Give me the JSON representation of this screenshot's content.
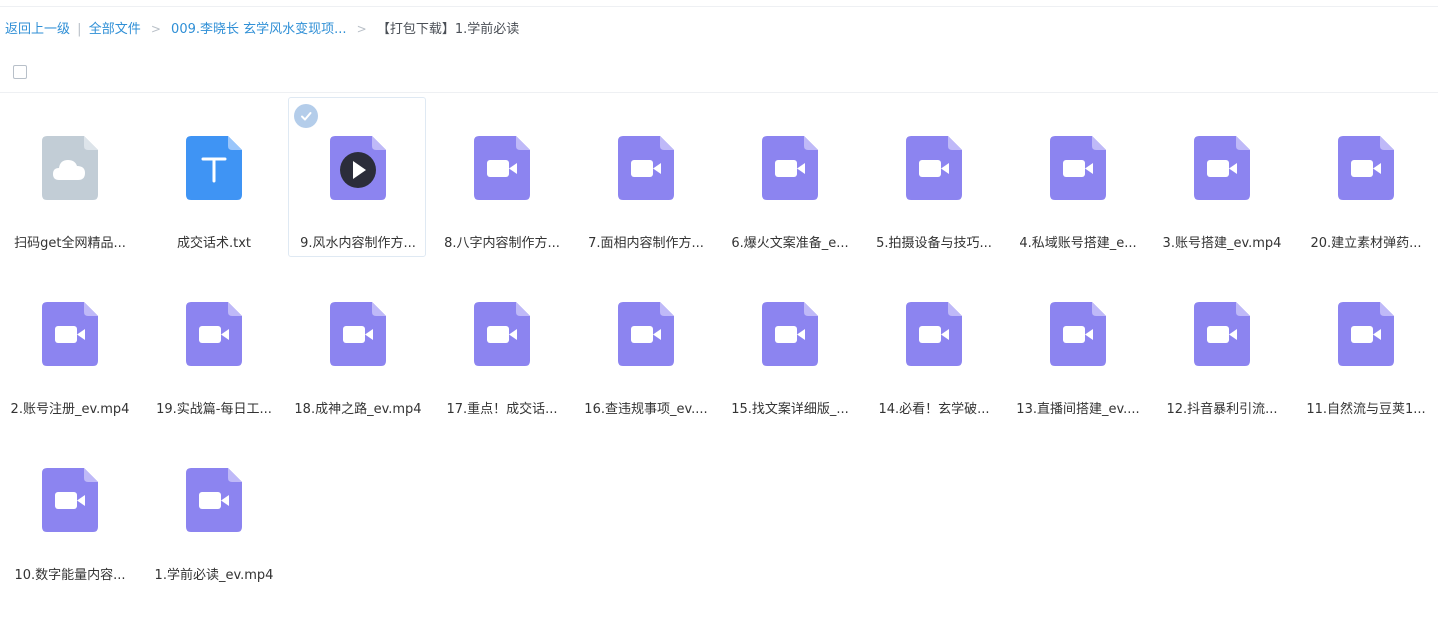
{
  "breadcrumb": {
    "back_label": "返回上一级",
    "sep": "|",
    "all_files": "全部文件",
    "folder": "009.李晓长 玄学风水变现项...",
    "arrow": ">",
    "current": "【打包下载】1.学前必读"
  },
  "colors": {
    "video": "#8c84f0",
    "video_fold": "#bfb9f8",
    "txt": "#3f94f4",
    "txt_fold": "#9ac6fb",
    "cloud": "#c2cdd6",
    "cloud_fold": "#dde4ea",
    "selection_check": "#b4cdea"
  },
  "files": [
    {
      "name": "扫码get全网精品...",
      "type": "cloud-file",
      "selected": false
    },
    {
      "name": "成交话术.txt",
      "type": "txt",
      "selected": false
    },
    {
      "name": "9.风水内容制作方...",
      "type": "video-play",
      "selected": true
    },
    {
      "name": "8.八字内容制作方...",
      "type": "video",
      "selected": false
    },
    {
      "name": "7.面相内容制作方...",
      "type": "video",
      "selected": false
    },
    {
      "name": "6.爆火文案准备_e...",
      "type": "video",
      "selected": false
    },
    {
      "name": "5.拍摄设备与技巧...",
      "type": "video",
      "selected": false
    },
    {
      "name": "4.私域账号搭建_e...",
      "type": "video",
      "selected": false
    },
    {
      "name": "3.账号搭建_ev.mp4",
      "type": "video",
      "selected": false
    },
    {
      "name": "20.建立素材弹药...",
      "type": "video",
      "selected": false
    },
    {
      "name": "2.账号注册_ev.mp4",
      "type": "video",
      "selected": false
    },
    {
      "name": "19.实战篇-每日工...",
      "type": "video",
      "selected": false
    },
    {
      "name": "18.成神之路_ev.mp4",
      "type": "video",
      "selected": false
    },
    {
      "name": "17.重点！成交话...",
      "type": "video",
      "selected": false
    },
    {
      "name": "16.查违规事项_ev....",
      "type": "video",
      "selected": false
    },
    {
      "name": "15.找文案详细版_...",
      "type": "video",
      "selected": false
    },
    {
      "name": "14.必看！玄学破...",
      "type": "video",
      "selected": false
    },
    {
      "name": "13.直播间搭建_ev....",
      "type": "video",
      "selected": false
    },
    {
      "name": "12.抖音暴利引流...",
      "type": "video",
      "selected": false
    },
    {
      "name": "11.自然流与豆荚1...",
      "type": "video",
      "selected": false
    },
    {
      "name": "10.数字能量内容...",
      "type": "video",
      "selected": false
    },
    {
      "name": "1.学前必读_ev.mp4",
      "type": "video",
      "selected": false
    }
  ]
}
